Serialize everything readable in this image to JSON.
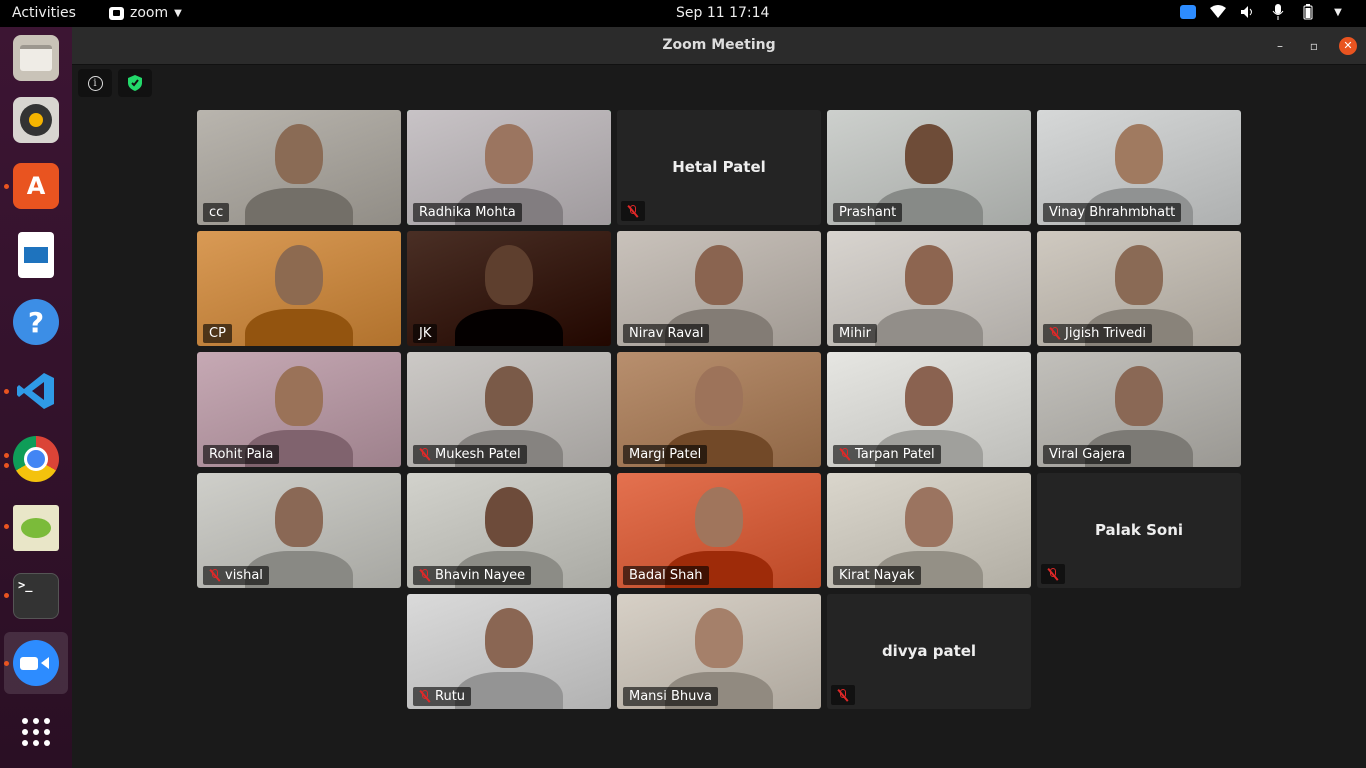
{
  "topbar": {
    "activities": "Activities",
    "app_name": "zoom",
    "clock": "Sep 11  17:14"
  },
  "window": {
    "title": "Zoom Meeting"
  },
  "participants": [
    {
      "name": "cc",
      "muted": false,
      "video": true,
      "bg": "#b9b5ae",
      "skin": "#8a6b55"
    },
    {
      "name": "Radhika Mohta",
      "muted": false,
      "video": true,
      "active": true,
      "bg": "#c8c3c6",
      "skin": "#9b7560"
    },
    {
      "name": "Hetal Patel",
      "muted": true,
      "video": false
    },
    {
      "name": "Prashant",
      "muted": false,
      "video": true,
      "bg": "#cdd0cd",
      "skin": "#6e4c38"
    },
    {
      "name": "Vinay Bhrahmbhatt",
      "muted": false,
      "video": true,
      "bg": "#d6d8d8",
      "skin": "#a07a60"
    },
    {
      "name": "CP",
      "muted": false,
      "video": true,
      "bg": "#d99a55",
      "skin": "#8d6a50"
    },
    {
      "name": "JK",
      "muted": false,
      "video": true,
      "bg": "#4a2f25",
      "skin": "#5e3f2e"
    },
    {
      "name": "Nirav Raval",
      "muted": false,
      "video": true,
      "bg": "#c9c2bb",
      "skin": "#8a6450"
    },
    {
      "name": "Mihir",
      "muted": false,
      "video": true,
      "bg": "#d8d4cf",
      "skin": "#8d6550"
    },
    {
      "name": "Jigish Trivedi",
      "muted": true,
      "video": true,
      "bg": "#cfc9c0",
      "skin": "#8a6a55"
    },
    {
      "name": "Rohit Pala",
      "muted": false,
      "video": true,
      "bg": "#c6a9b4",
      "skin": "#9a7258"
    },
    {
      "name": "Mukesh Patel",
      "muted": true,
      "video": true,
      "bg": "#ccc9c6",
      "skin": "#7a5a48"
    },
    {
      "name": "Margi Patel",
      "muted": false,
      "video": true,
      "bg": "#b88f6e",
      "skin": "#9d735a"
    },
    {
      "name": "Tarpan Patel",
      "muted": true,
      "video": true,
      "bg": "#e6e6e2",
      "skin": "#8a6250"
    },
    {
      "name": "Viral Gajera",
      "muted": false,
      "video": true,
      "bg": "#c2c0bb",
      "skin": "#8a6855"
    },
    {
      "name": "vishal",
      "muted": true,
      "video": true,
      "bg": "#cfcfca",
      "skin": "#8a6855"
    },
    {
      "name": "Bhavin Nayee",
      "muted": true,
      "video": true,
      "bg": "#d2d2cc",
      "skin": "#6d4b3a"
    },
    {
      "name": "Badal Shah",
      "muted": false,
      "video": true,
      "bg": "#e4714f",
      "skin": "#a0755c"
    },
    {
      "name": "Kirat Nayak",
      "muted": false,
      "video": true,
      "bg": "#dad6cc",
      "skin": "#9b7460"
    },
    {
      "name": "Palak Soni",
      "muted": true,
      "video": false
    },
    {
      "name": "Rutu",
      "muted": true,
      "video": true,
      "bg": "#dadada",
      "skin": "#8a6653"
    },
    {
      "name": "Mansi Bhuva",
      "muted": false,
      "video": true,
      "bg": "#d7d0c6",
      "skin": "#a5806a"
    },
    {
      "name": "divya patel",
      "muted": true,
      "video": false
    }
  ]
}
